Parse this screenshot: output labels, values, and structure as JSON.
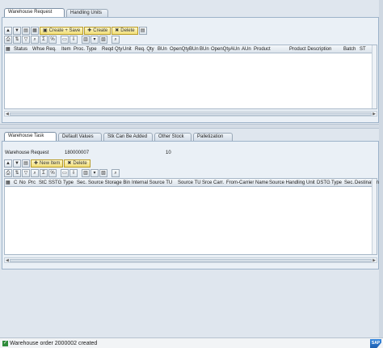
{
  "top_panel": {
    "tabs": [
      {
        "label": "Warehouse Request",
        "active": true
      },
      {
        "label": "Handling Units",
        "active": false
      }
    ],
    "toolbar": {
      "create_save": "Create + Save",
      "create": "Create",
      "delete": "Delete"
    },
    "columns": [
      "Status",
      "Whse Req.",
      "Item",
      "Proc. Type",
      "Reqd Qty",
      "Unit",
      "Req. Qty",
      "BUn",
      "OpenQtyBUn",
      "BUn",
      "OpenQtyAUn",
      "AUn",
      "Product",
      "Product Description",
      "Batch",
      "ST"
    ]
  },
  "bottom_panel": {
    "tabs": [
      {
        "label": "Warehouse Task",
        "active": true
      },
      {
        "label": "Default Values",
        "active": false
      },
      {
        "label": "Stk Can Be Added",
        "active": false
      },
      {
        "label": "Other Stock",
        "active": false
      },
      {
        "label": "Palletization",
        "active": false
      }
    ],
    "request_label": "Warehouse Request",
    "request_number": "180000007",
    "request_item": "10",
    "toolbar": {
      "new_item": "New Item",
      "delete": "Delete"
    },
    "columns": [
      "C",
      "No",
      "Prc",
      "StC",
      "SSTG",
      "Type",
      "Sec.",
      "Source Storage Bin",
      "Internal Source TU",
      "Source TU",
      "Srce Carr.",
      "From-Carrier Name",
      "Source Handling Unit",
      "DSTG",
      "Type",
      "Sec.",
      "Destination"
    ]
  },
  "status_bar": {
    "message": "Warehouse order 2000002 created",
    "logo": "SAP"
  },
  "colors": {
    "accent": "#f1de78",
    "background": "#dfe6ee",
    "success": "#2e8b3a"
  },
  "icons": [
    "arrow-up-icon",
    "arrow-down-icon",
    "details-icon",
    "save-icon",
    "create-icon",
    "delete-icon",
    "print-icon",
    "filter-icon",
    "sum-icon",
    "layout-icon",
    "export-icon",
    "find-icon"
  ]
}
